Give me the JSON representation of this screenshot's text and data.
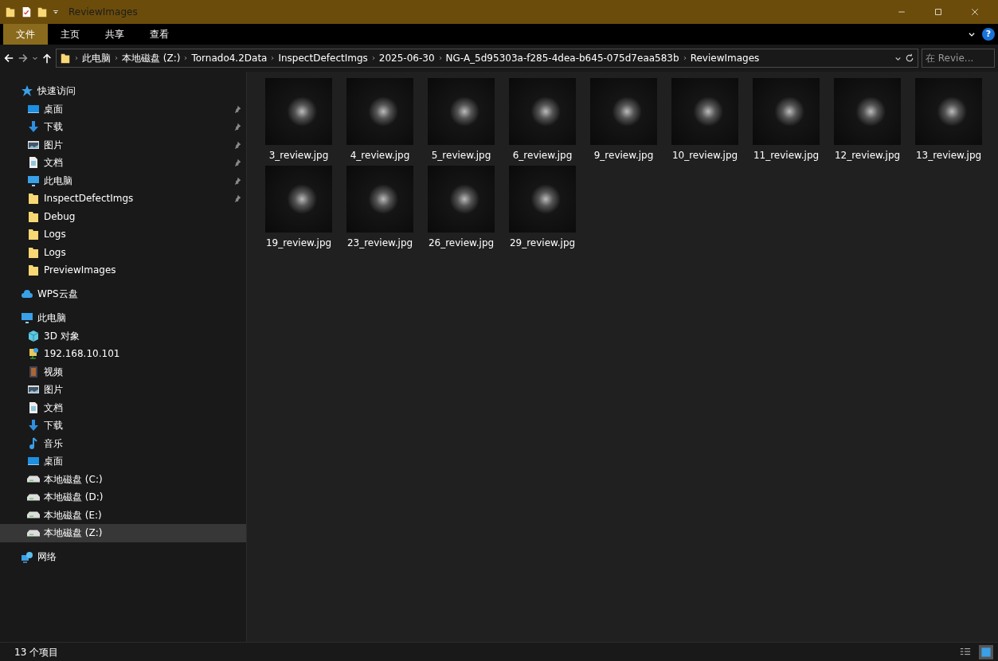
{
  "window": {
    "title": "ReviewImages"
  },
  "ribbon_tabs": [
    {
      "label": "文件",
      "selected": true
    },
    {
      "label": "主页",
      "selected": false
    },
    {
      "label": "共享",
      "selected": false
    },
    {
      "label": "查看",
      "selected": false
    }
  ],
  "address": {
    "crumbs": [
      "此电脑",
      "本地磁盘 (Z:)",
      "Tornado4.2Data",
      "InspectDefectImgs",
      "2025-06-30",
      "NG-A_5d95303a-f285-4dea-b645-075d7eaa583b",
      "ReviewImages"
    ]
  },
  "search": {
    "placeholder": "在 Revie..."
  },
  "help_button": {
    "label": "?"
  },
  "sidebar": [
    {
      "label": "快速访问",
      "kind": "star",
      "selected": false,
      "children": [
        {
          "label": "桌面",
          "kind": "desktop",
          "pinned": true,
          "selected": false
        },
        {
          "label": "下载",
          "kind": "download",
          "pinned": true,
          "selected": false
        },
        {
          "label": "图片",
          "kind": "pictures",
          "pinned": true,
          "selected": false
        },
        {
          "label": "文档",
          "kind": "document",
          "pinned": true,
          "selected": false
        },
        {
          "label": "此电脑",
          "kind": "computer",
          "pinned": true,
          "selected": false
        },
        {
          "label": "InspectDefectImgs",
          "kind": "folder",
          "pinned": true,
          "selected": false
        },
        {
          "label": "Debug",
          "kind": "folder",
          "pinned": false,
          "selected": false
        },
        {
          "label": "Logs",
          "kind": "folder",
          "pinned": false,
          "selected": false
        },
        {
          "label": "Logs",
          "kind": "folder",
          "pinned": false,
          "selected": false
        },
        {
          "label": "PreviewImages",
          "kind": "folder",
          "pinned": false,
          "selected": false
        }
      ]
    },
    {
      "label": "WPS云盘",
      "kind": "cloud",
      "selected": false
    },
    {
      "label": "此电脑",
      "kind": "computer",
      "selected": false,
      "children": [
        {
          "label": "3D 对象",
          "kind": "cube",
          "pinned": false,
          "selected": false
        },
        {
          "label": "192.168.10.101",
          "kind": "netdrive",
          "pinned": false,
          "selected": false
        },
        {
          "label": "视频",
          "kind": "video",
          "pinned": false,
          "selected": false
        },
        {
          "label": "图片",
          "kind": "pictures",
          "pinned": false,
          "selected": false
        },
        {
          "label": "文档",
          "kind": "document",
          "pinned": false,
          "selected": false
        },
        {
          "label": "下载",
          "kind": "download",
          "pinned": false,
          "selected": false
        },
        {
          "label": "音乐",
          "kind": "music",
          "pinned": false,
          "selected": false
        },
        {
          "label": "桌面",
          "kind": "desktop",
          "pinned": false,
          "selected": false
        },
        {
          "label": "本地磁盘 (C:)",
          "kind": "drive",
          "pinned": false,
          "selected": false
        },
        {
          "label": "本地磁盘 (D:)",
          "kind": "drive",
          "pinned": false,
          "selected": false
        },
        {
          "label": "本地磁盘 (E:)",
          "kind": "drive",
          "pinned": false,
          "selected": false
        },
        {
          "label": "本地磁盘 (Z:)",
          "kind": "drive",
          "pinned": false,
          "selected": true
        }
      ]
    },
    {
      "label": "网络",
      "kind": "network",
      "selected": false
    }
  ],
  "files": [
    "3_review.jpg",
    "4_review.jpg",
    "5_review.jpg",
    "6_review.jpg",
    "9_review.jpg",
    "10_review.jpg",
    "11_review.jpg",
    "12_review.jpg",
    "13_review.jpg",
    "19_review.jpg",
    "23_review.jpg",
    "26_review.jpg",
    "29_review.jpg"
  ],
  "status_bar": {
    "count": "13 个项目"
  }
}
